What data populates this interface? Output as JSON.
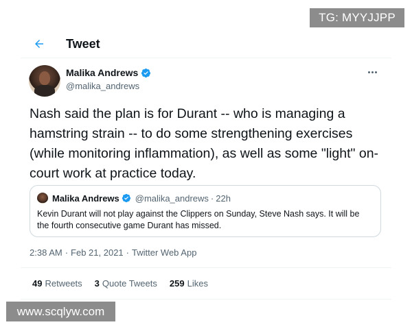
{
  "watermarks": {
    "top": "TG: MYYJJPP",
    "bottom": "www.scqlyw.com"
  },
  "header": {
    "back_icon": "arrow-left-icon",
    "title": "Tweet"
  },
  "author": {
    "name": "Malika Andrews",
    "handle": "@malika_andrews",
    "verified_icon": "verified-badge-icon",
    "more_icon": "more-dots-icon"
  },
  "tweet": {
    "text": "Nash said the plan is for Durant -- who is managing a hamstring strain -- to do some strengthening exercises (while monitoring inflammation), as well as some \"light\" on-court work at practice today."
  },
  "quote": {
    "name": "Malika Andrews",
    "handle": "@malika_andrews",
    "separator": "·",
    "time": "22h",
    "text": "Kevin Durant will not play against the Clippers on Sunday, Steve Nash says. It will be the fourth consecutive game Durant has missed."
  },
  "meta": {
    "time": "2:38 AM",
    "separator": "·",
    "date": "Feb 21, 2021",
    "source": "Twitter Web App"
  },
  "stats": {
    "retweets_count": "49",
    "retweets_label": "Retweets",
    "quotes_count": "3",
    "quotes_label": "Quote Tweets",
    "likes_count": "259",
    "likes_label": "Likes"
  },
  "colors": {
    "accent": "#1d9bf0",
    "text": "#0f1419",
    "muted": "#536471",
    "border": "#cfd9de"
  }
}
